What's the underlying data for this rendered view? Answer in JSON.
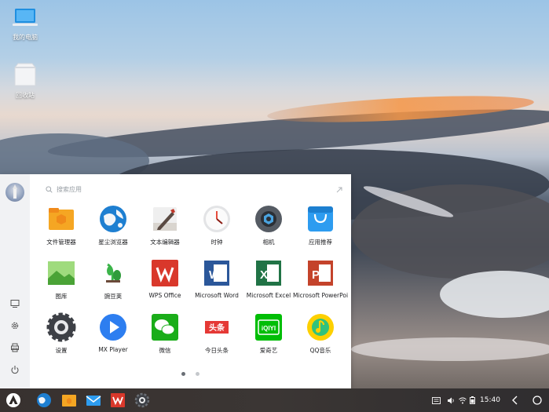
{
  "desktop": {
    "icons": [
      {
        "label": "我的电脑",
        "icon": "laptop-icon"
      },
      {
        "label": "回收站",
        "icon": "trash-bin-icon"
      }
    ]
  },
  "launcher": {
    "search": {
      "placeholder": "搜索应用"
    },
    "apps": [
      {
        "label": "文件管理器",
        "icon": "folder-icon",
        "color": "#f5a623"
      },
      {
        "label": "星尘浏览器",
        "icon": "globe-icon",
        "color": "#1e7fd1"
      },
      {
        "label": "文本编辑器",
        "icon": "text-editor-icon",
        "color": "#c0392b"
      },
      {
        "label": "时钟",
        "icon": "clock-icon",
        "color": "#e74c3c"
      },
      {
        "label": "相机",
        "icon": "camera-icon",
        "color": "#555b63"
      },
      {
        "label": "应用推荐",
        "icon": "app-store-icon",
        "color": "#2d9cf0"
      },
      {
        "label": "图库",
        "icon": "gallery-icon",
        "color": "#5fb848"
      },
      {
        "label": "豌豆荚",
        "icon": "pea-pod-icon",
        "color": "#3cb44a"
      },
      {
        "label": "WPS Office",
        "icon": "wps-icon",
        "color": "#d9382b"
      },
      {
        "label": "Microsoft Word",
        "icon": "word-icon",
        "color": "#2b579a"
      },
      {
        "label": "Microsoft Excel",
        "icon": "excel-icon",
        "color": "#217346"
      },
      {
        "label": "Microsoft PowerPoi",
        "icon": "powerpoint-icon",
        "color": "#c4432b"
      },
      {
        "label": "设置",
        "icon": "settings-icon",
        "color": "#3d4046"
      },
      {
        "label": "MX Player",
        "icon": "play-icon",
        "color": "#2d7ef0"
      },
      {
        "label": "微信",
        "icon": "wechat-icon",
        "color": "#1aad19"
      },
      {
        "label": "今日头条",
        "icon": "toutiao-icon",
        "color": "#e53935",
        "text": "头条"
      },
      {
        "label": "爱奇艺",
        "icon": "iqiyi-icon",
        "color": "#00be06",
        "text": "iQIYI"
      },
      {
        "label": "QQ音乐",
        "icon": "qq-music-icon",
        "color": "#31c27c"
      }
    ],
    "page_dots": {
      "count": 2,
      "active": 0
    }
  },
  "taskbar": {
    "time": "15:40",
    "pinned": [
      "start-logo-icon",
      "browser-icon",
      "folder-icon",
      "mail-icon",
      "wps-icon",
      "settings-icon"
    ]
  }
}
